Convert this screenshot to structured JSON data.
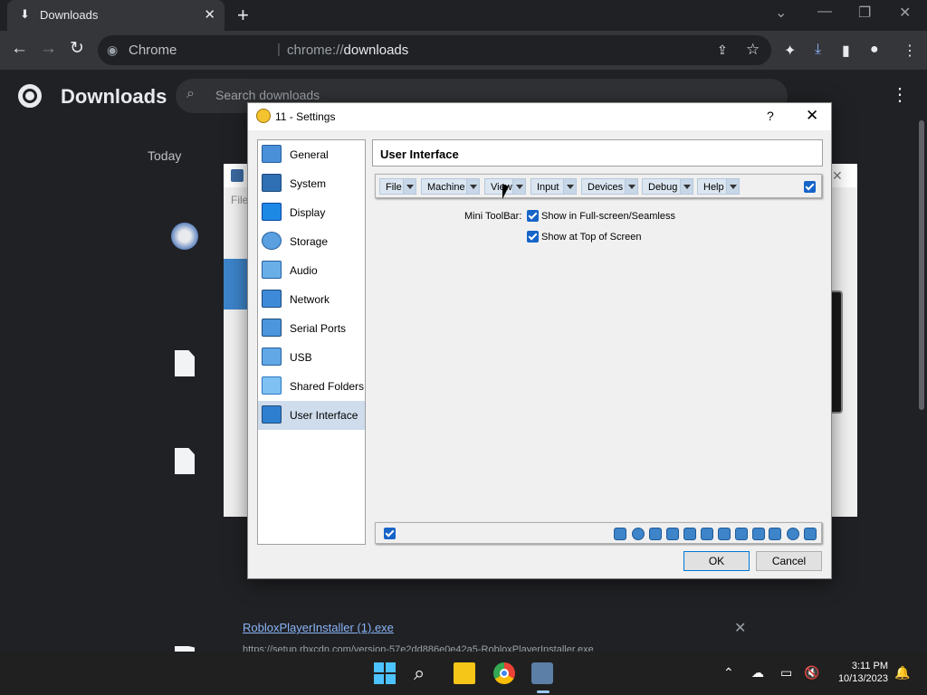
{
  "browser": {
    "tab_title": "Downloads",
    "omnibox_site": "Chrome",
    "omnibox_url_prefix": "chrome://",
    "omnibox_url_path": "downloads"
  },
  "downloads_page": {
    "title": "Downloads",
    "search_placeholder": "Search downloads",
    "date_group": "Today",
    "last_item_name": "RobloxPlayerInstaller (1).exe",
    "last_item_url": "https://setup.rbxcdn.com/version-57e2dd886e0e42a5-RobloxPlayerInstaller.exe"
  },
  "background_window": {
    "menu_file": "File"
  },
  "dialog": {
    "title": "11 - Settings",
    "help": "?",
    "close": "✕",
    "sections": [
      {
        "label": "General"
      },
      {
        "label": "System"
      },
      {
        "label": "Display"
      },
      {
        "label": "Storage"
      },
      {
        "label": "Audio"
      },
      {
        "label": "Network"
      },
      {
        "label": "Serial Ports"
      },
      {
        "label": "USB"
      },
      {
        "label": "Shared Folders"
      },
      {
        "label": "User Interface"
      }
    ],
    "selected_section": "User Interface",
    "page_title": "User Interface",
    "menu_buttons": [
      {
        "label": "File"
      },
      {
        "label": "Machine"
      },
      {
        "label": "View"
      },
      {
        "label": "Input"
      },
      {
        "label": "Devices"
      },
      {
        "label": "Debug"
      },
      {
        "label": "Help"
      }
    ],
    "menubar_enabled": true,
    "mini_toolbar_label": "Mini ToolBar:",
    "mini_toolbar_options": [
      {
        "label": "Show in Full-screen/Seamless",
        "checked": true
      },
      {
        "label": "Show at Top of Screen",
        "checked": true
      }
    ],
    "statusbar_enabled": true,
    "ok_label": "OK",
    "cancel_label": "Cancel"
  },
  "taskbar": {
    "time": "3:11 PM",
    "date": "10/13/2023"
  },
  "colors": {
    "accent": "#1764c8",
    "selected_section": "#cfdcec",
    "chrome_bg": "#202124"
  }
}
